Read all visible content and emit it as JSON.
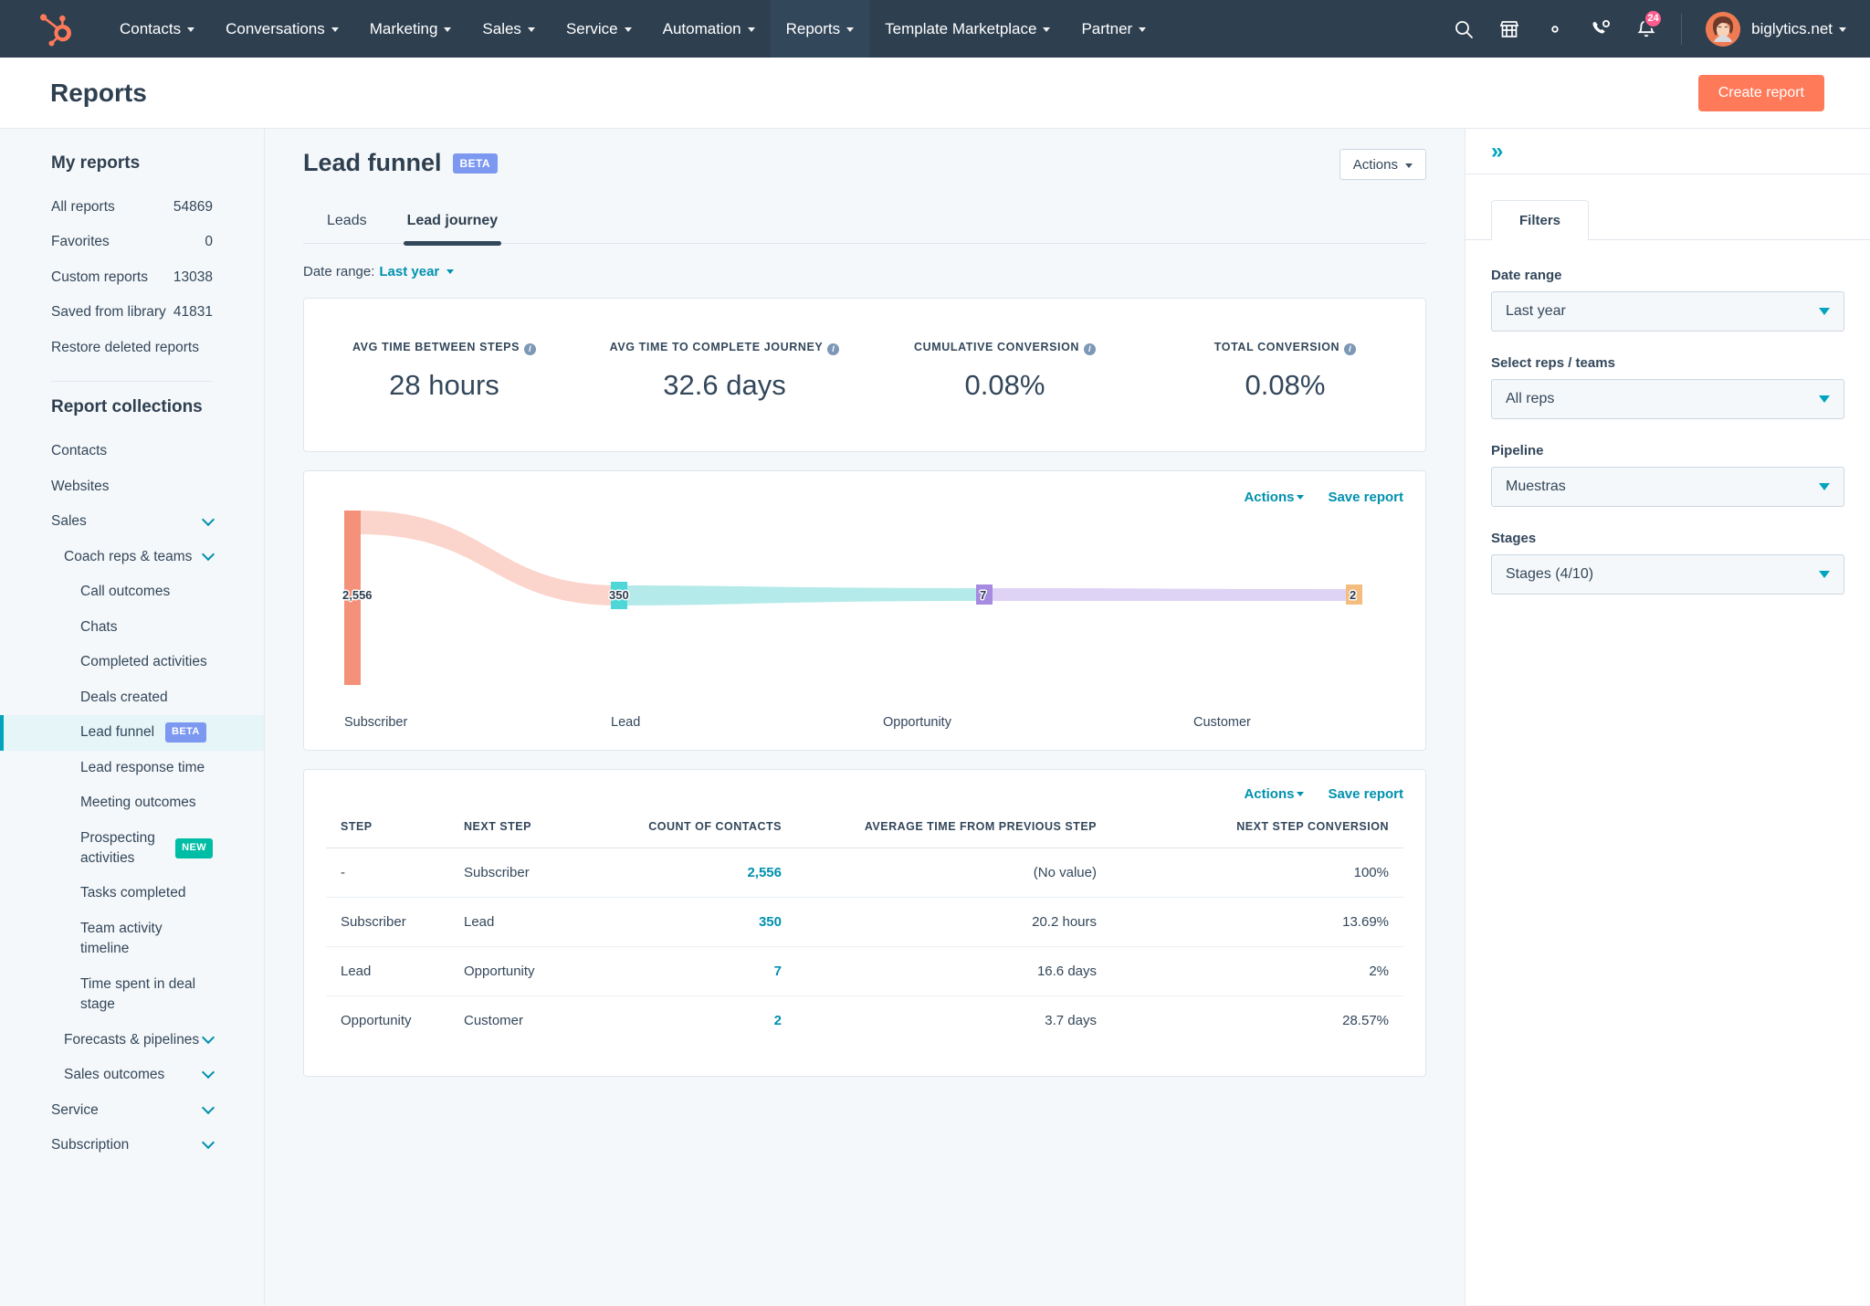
{
  "topnav": {
    "logo_icon": "hubspot-sprocket-logo",
    "items": [
      {
        "label": "Contacts",
        "has_caret": true
      },
      {
        "label": "Conversations",
        "has_caret": true
      },
      {
        "label": "Marketing",
        "has_caret": true
      },
      {
        "label": "Sales",
        "has_caret": true
      },
      {
        "label": "Service",
        "has_caret": true
      },
      {
        "label": "Automation",
        "has_caret": true
      },
      {
        "label": "Reports",
        "has_caret": true,
        "active": true
      },
      {
        "label": "Template Marketplace",
        "has_caret": true
      },
      {
        "label": "Partner",
        "has_caret": true
      }
    ],
    "icons": [
      "search-icon",
      "marketplace-icon",
      "gear-icon",
      "phone-icon",
      "notifications-icon"
    ],
    "notification_count": "24",
    "account_name": "biglytics.net"
  },
  "page_header": {
    "title": "Reports",
    "create_button": "Create report"
  },
  "sidebar": {
    "my_reports_title": "My reports",
    "my_reports": [
      {
        "label": "All reports",
        "count": "54869"
      },
      {
        "label": "Favorites",
        "count": "0"
      },
      {
        "label": "Custom reports",
        "count": "13038"
      },
      {
        "label": "Saved from library",
        "count": "41831"
      },
      {
        "label": "Restore deleted reports",
        "count": ""
      }
    ],
    "collections_title": "Report collections",
    "collections": [
      {
        "label": "Contacts",
        "level": 0,
        "chevron": false
      },
      {
        "label": "Websites",
        "level": 0,
        "chevron": false
      },
      {
        "label": "Sales",
        "level": 0,
        "chevron": true
      },
      {
        "label": "Coach reps & teams",
        "level": 1,
        "chevron": true
      },
      {
        "label": "Call outcomes",
        "level": 2,
        "chevron": false
      },
      {
        "label": "Chats",
        "level": 2,
        "chevron": false
      },
      {
        "label": "Completed activities",
        "level": 2,
        "chevron": false
      },
      {
        "label": "Deals created",
        "level": 2,
        "chevron": false
      },
      {
        "label": "Lead funnel",
        "level": 2,
        "chevron": false,
        "badge": "BETA",
        "badge_type": "beta",
        "selected": true
      },
      {
        "label": "Lead response time",
        "level": 2,
        "chevron": false
      },
      {
        "label": "Meeting outcomes",
        "level": 2,
        "chevron": false
      },
      {
        "label": "Prospecting activities",
        "level": 2,
        "chevron": false,
        "badge": "NEW",
        "badge_type": "new"
      },
      {
        "label": "Tasks completed",
        "level": 2,
        "chevron": false
      },
      {
        "label": "Team activity timeline",
        "level": 2,
        "chevron": false
      },
      {
        "label": "Time spent in deal stage",
        "level": 2,
        "chevron": false
      },
      {
        "label": "Forecasts & pipelines",
        "level": 1,
        "chevron": true
      },
      {
        "label": "Sales outcomes",
        "level": 1,
        "chevron": true
      },
      {
        "label": "Service",
        "level": 0,
        "chevron": true
      },
      {
        "label": "Subscription",
        "level": 0,
        "chevron": true
      }
    ]
  },
  "report": {
    "title": "Lead funnel",
    "badge": "BETA",
    "actions_label": "Actions",
    "tabs": [
      {
        "label": "Leads",
        "active": false
      },
      {
        "label": "Lead journey",
        "active": true
      }
    ],
    "date_range_prefix": "Date range:",
    "date_range_value": "Last year"
  },
  "kpis": [
    {
      "label": "AVG TIME BETWEEN STEPS",
      "value": "28 hours",
      "info": true
    },
    {
      "label": "AVG TIME TO COMPLETE JOURNEY",
      "value": "32.6 days",
      "info": true
    },
    {
      "label": "CUMULATIVE CONVERSION",
      "value": "0.08%",
      "info": true
    },
    {
      "label": "TOTAL CONVERSION",
      "value": "0.08%",
      "info": true
    }
  ],
  "chart_card": {
    "actions_label": "Actions",
    "save_label": "Save report"
  },
  "table_card": {
    "actions_label": "Actions",
    "save_label": "Save report",
    "columns": [
      "STEP",
      "NEXT STEP",
      "COUNT OF CONTACTS",
      "AVERAGE TIME FROM PREVIOUS STEP",
      "NEXT STEP CONVERSION"
    ],
    "rows": [
      {
        "step": "-",
        "next_step": "Subscriber",
        "count": "2,556",
        "avg_time": "(No value)",
        "conversion": "100%"
      },
      {
        "step": "Subscriber",
        "next_step": "Lead",
        "count": "350",
        "avg_time": "20.2 hours",
        "conversion": "13.69%"
      },
      {
        "step": "Lead",
        "next_step": "Opportunity",
        "count": "7",
        "avg_time": "16.6 days",
        "conversion": "2%"
      },
      {
        "step": "Opportunity",
        "next_step": "Customer",
        "count": "2",
        "avg_time": "3.7 days",
        "conversion": "28.57%"
      }
    ]
  },
  "filters_panel": {
    "collapse_icon": "chevron-double-right-icon",
    "tab_label": "Filters",
    "fields": [
      {
        "label": "Date range",
        "value": "Last year"
      },
      {
        "label": "Select reps / teams",
        "value": "All reps"
      },
      {
        "label": "Pipeline",
        "value": "Muestras"
      },
      {
        "label": "Stages",
        "value": "Stages (4/10)"
      }
    ]
  },
  "chart_data": {
    "type": "sankey",
    "title": "Lead journey funnel",
    "stages": [
      "Subscriber",
      "Lead",
      "Opportunity",
      "Customer"
    ],
    "values": [
      2556,
      350,
      7,
      2
    ],
    "value_labels": [
      "2,556",
      "350",
      "7",
      "2"
    ],
    "node_colors": [
      "#f4917a",
      "#4fd6d6",
      "#a78be0",
      "#f4bd7f"
    ],
    "link_colors": [
      "#fbd4cb",
      "#b4eaea",
      "#ded3f4"
    ],
    "links": [
      {
        "source": "Subscriber",
        "target": "Lead",
        "value": 350
      },
      {
        "source": "Lead",
        "target": "Opportunity",
        "value": 7
      },
      {
        "source": "Opportunity",
        "target": "Customer",
        "value": 2
      }
    ]
  }
}
